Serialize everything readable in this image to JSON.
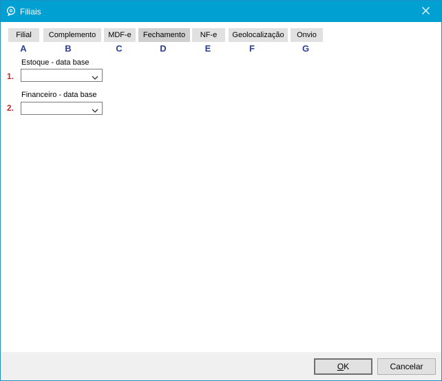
{
  "window": {
    "title": "Filiais"
  },
  "tabs": [
    {
      "label": "Filial",
      "letter": "A",
      "active": false
    },
    {
      "label": "Complemento",
      "letter": "B",
      "active": false
    },
    {
      "label": "MDF-e",
      "letter": "C",
      "active": false
    },
    {
      "label": "Fechamento",
      "letter": "D",
      "active": true
    },
    {
      "label": "NF-e",
      "letter": "E",
      "active": false
    },
    {
      "label": "Geolocalização",
      "letter": "F",
      "active": false
    },
    {
      "label": "Onvio",
      "letter": "G",
      "active": false
    }
  ],
  "fields": [
    {
      "marker": "1.",
      "label": "Estoque - data base",
      "value": ""
    },
    {
      "marker": "2.",
      "label": "Financeiro - data base",
      "value": ""
    }
  ],
  "buttons": {
    "ok_mnemonic": "O",
    "ok_rest": "K",
    "cancel_label": "Cancelar"
  },
  "colors": {
    "titlebar": "#00a0d2",
    "tab_letter": "#2b3f96",
    "marker": "#c0282b"
  },
  "icons": {
    "app": "chat-bubble-icon",
    "close": "close-icon",
    "dropdown": "chevron-down-icon"
  }
}
